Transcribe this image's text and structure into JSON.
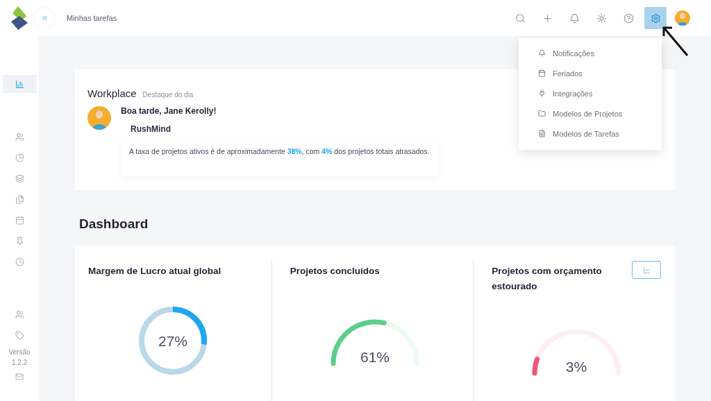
{
  "topbar": {
    "title": "Minhas tarefas",
    "actions": [
      {
        "kind": "search",
        "selected": false
      },
      {
        "kind": "add",
        "selected": false
      },
      {
        "kind": "bell",
        "selected": false
      },
      {
        "kind": "sun",
        "selected": false
      },
      {
        "kind": "help",
        "selected": false
      },
      {
        "kind": "settings",
        "selected": true
      }
    ]
  },
  "sidebar": {
    "top_items": [
      {
        "kind": "chart",
        "selected": true
      }
    ],
    "items": [
      {
        "kind": "users",
        "selected": false
      },
      {
        "kind": "pie",
        "selected": false
      },
      {
        "kind": "layers",
        "selected": false
      },
      {
        "kind": "files",
        "selected": false
      },
      {
        "kind": "calendar",
        "selected": false
      },
      {
        "kind": "pin",
        "selected": false
      },
      {
        "kind": "clock",
        "selected": false
      }
    ],
    "bottom_items": [
      {
        "kind": "users",
        "selected": false
      },
      {
        "kind": "tag",
        "selected": false
      }
    ],
    "version_label": "Versão",
    "version": "1.2.2"
  },
  "settings_menu": {
    "items": [
      {
        "kind": "bell",
        "label": "Notificações"
      },
      {
        "kind": "calendar",
        "label": "Feriados"
      },
      {
        "kind": "plug",
        "label": "Integrações"
      },
      {
        "kind": "folder",
        "label": "Modelos de Projetos"
      },
      {
        "kind": "file",
        "label": "Modelos de Tarefas"
      }
    ]
  },
  "workplace": {
    "title": "Workplace",
    "subtitle": "Destaque do dia",
    "greeting": "Boa tarde, Jane Kerolly!",
    "company": "RushMind",
    "summary": "A taxa de projetos ativos é de aproximadamente **38%**, com **4%** dos projetos totais atrasados."
  },
  "dashboard": {
    "title": "Dashboard",
    "cards": [
      {
        "title": "Margem de Lucro atual global",
        "kind": "ring",
        "level": 0.27,
        "reading": "27%",
        "color": "#1ea7f0"
      },
      {
        "title": "Projetos concluídos",
        "kind": "arc",
        "level": 0.61,
        "reading": "61%",
        "color": "#5ccf8a"
      },
      {
        "title": "Projetos com orçamento estourado",
        "kind": "arc",
        "level": 0.03,
        "reading": "3%",
        "color": "#f0567a",
        "chart_button": true
      }
    ]
  }
}
